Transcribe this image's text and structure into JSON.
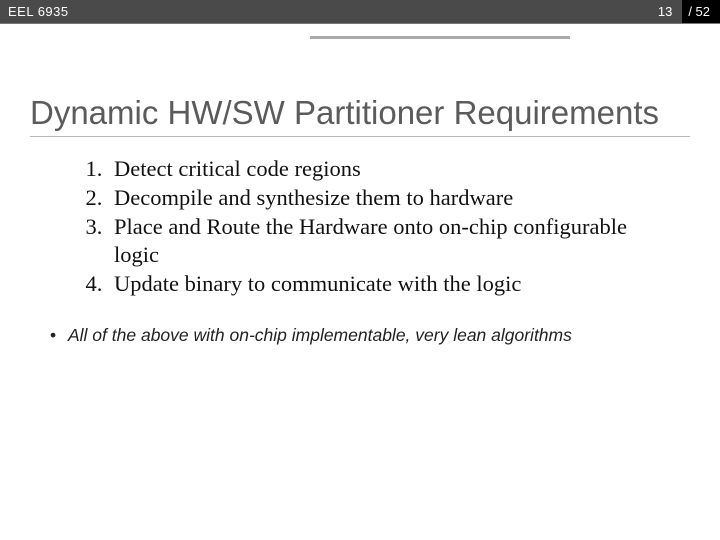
{
  "header": {
    "course": "EEL 6935",
    "page_current": "13",
    "page_total": "/ 52"
  },
  "title": "Dynamic HW/SW Partitioner Requirements",
  "items": [
    "Detect critical code regions",
    "Decompile and synthesize them to hardware",
    "Place and Route the Hardware onto on-chip configurable logic",
    "Update binary to communicate with the logic"
  ],
  "footnote": "All of the above with on-chip implementable, very lean algorithms"
}
